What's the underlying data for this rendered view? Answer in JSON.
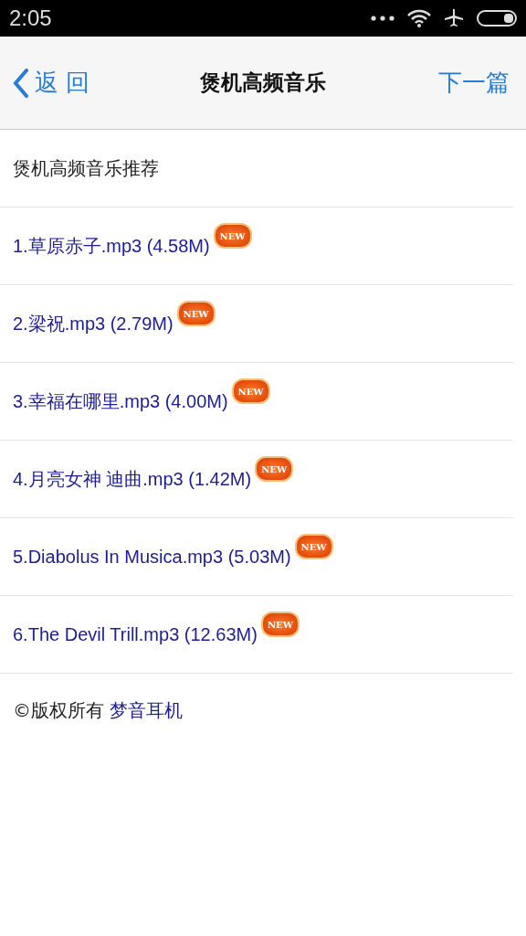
{
  "status_bar": {
    "time": "2:05"
  },
  "nav": {
    "back": "返 回",
    "title": "煲机高频音乐",
    "next": "下一篇"
  },
  "heading": "煲机高频音乐推荐",
  "tracks": [
    {
      "label": "1.草原赤子.mp3 (4.58M)",
      "badge": "NEW"
    },
    {
      "label": "2.梁祝.mp3 (2.79M)",
      "badge": "NEW"
    },
    {
      "label": "3.幸福在哪里.mp3 (4.00M)",
      "badge": "NEW"
    },
    {
      "label": "4.月亮女神 迪曲.mp3 (1.42M)",
      "badge": "NEW"
    },
    {
      "label": "5.Diabolus In Musica.mp3 (5.03M)",
      "badge": "NEW"
    },
    {
      "label": "6.The Devil Trill.mp3 (12.63M)",
      "badge": "NEW"
    }
  ],
  "footer": {
    "text": "©版权所有",
    "link": "梦音耳机"
  }
}
